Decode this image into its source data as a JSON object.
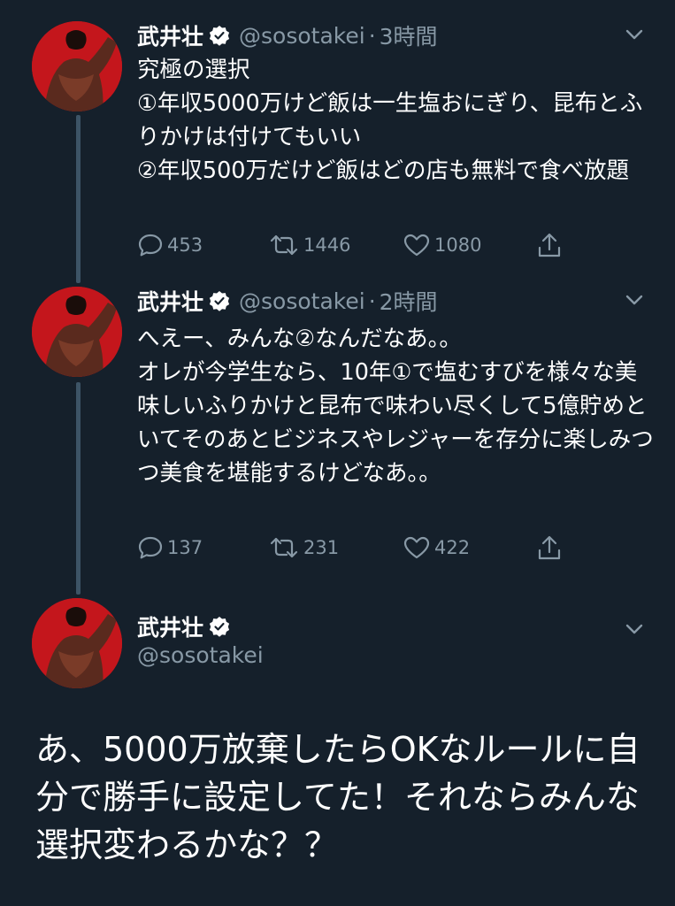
{
  "tweets": [
    {
      "name": "武井壮",
      "handle": "@sosotakei",
      "dot": "·",
      "time": "3時間",
      "text": "究極の選択\n①年収5000万けど飯は一生塩おにぎり、昆布とふりかけは付けてもいい\n②年収500万だけど飯はどの店も無料で食べ放題",
      "replies": "453",
      "retweets": "1446",
      "likes": "1080"
    },
    {
      "name": "武井壮",
      "handle": "@sosotakei",
      "dot": "·",
      "time": "2時間",
      "text": "へえー、みんな②なんだなあ。。\nオレが今学生なら、10年①で塩むすびを様々な美味しいふりかけと昆布で味わい尽くして5億貯めといてそのあとビジネスやレジャーを存分に楽しみつつ美食を堪能するけどなあ。。",
      "replies": "137",
      "retweets": "231",
      "likes": "422"
    },
    {
      "name": "武井壮",
      "handle": "@sosotakei",
      "text": "あ、5000万放棄したらOKなルールに自分で勝手に設定してた！それならみんな選択変わるかな？？"
    }
  ],
  "colors": {
    "background": "#15202b",
    "secondary_text": "#8899a6",
    "thread_line": "#3d5466",
    "verified_badge": "#ffffff"
  },
  "icons": [
    "verified-badge-icon",
    "chevron-down-icon",
    "reply-icon",
    "retweet-icon",
    "like-icon",
    "share-icon"
  ]
}
